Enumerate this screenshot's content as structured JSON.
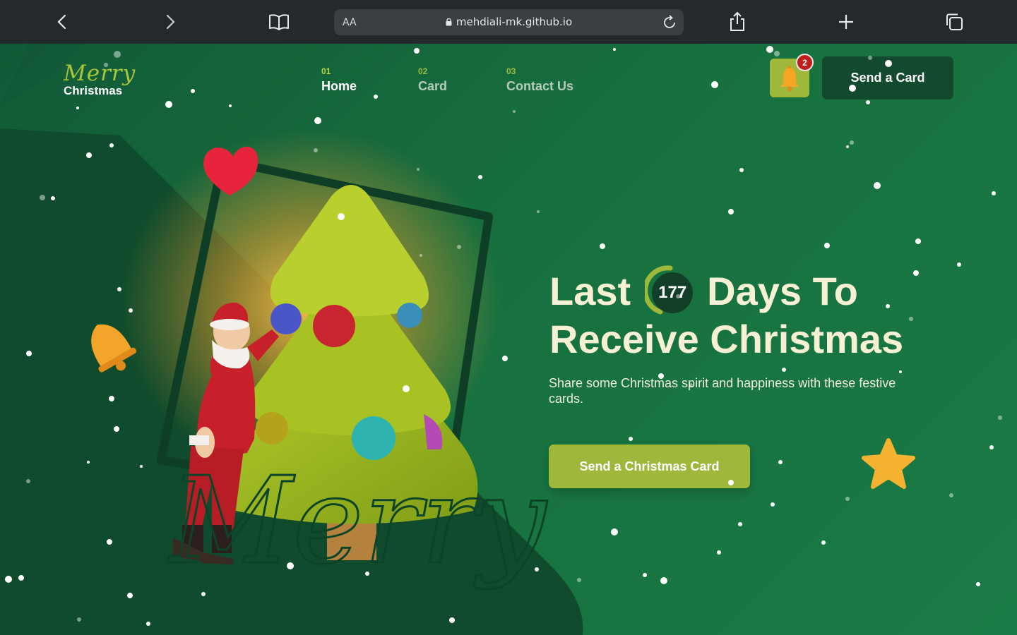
{
  "browser": {
    "text_size_label": "AA",
    "url": "mehdiali-mk.github.io",
    "icons": [
      "back-icon",
      "forward-icon",
      "bookmarks-icon",
      "lock-icon",
      "reload-icon",
      "share-icon",
      "new-tab-icon",
      "tabs-icon"
    ]
  },
  "logo": {
    "script": "Merry",
    "word": "Christmas"
  },
  "nav": [
    {
      "num": "01",
      "label": "Home",
      "active": true
    },
    {
      "num": "02",
      "label": "Card",
      "active": false
    },
    {
      "num": "03",
      "label": "Contact Us",
      "active": false
    }
  ],
  "notifications": {
    "count": "2",
    "icon": "bell-icon"
  },
  "header_button": "Send a Card",
  "hero": {
    "title_before": "Last",
    "days": "177",
    "title_after": "Days To",
    "title_line2": "Receive Christmas",
    "subtitle": "Share some Christmas spirit and happiness with these festive cards.",
    "cta": "Send a Christmas Card"
  },
  "decor": {
    "script_word": "Merry",
    "icons": [
      "heart-icon",
      "bell-icon",
      "star-icon",
      "christmas-tree-illustration",
      "santa-illustration"
    ]
  },
  "colors": {
    "accent": "#9db83a",
    "background": "#1a6b3c",
    "dark_green": "#134a2e",
    "badge_red": "#c01e1e",
    "hero_text": "#f6f1d4"
  }
}
